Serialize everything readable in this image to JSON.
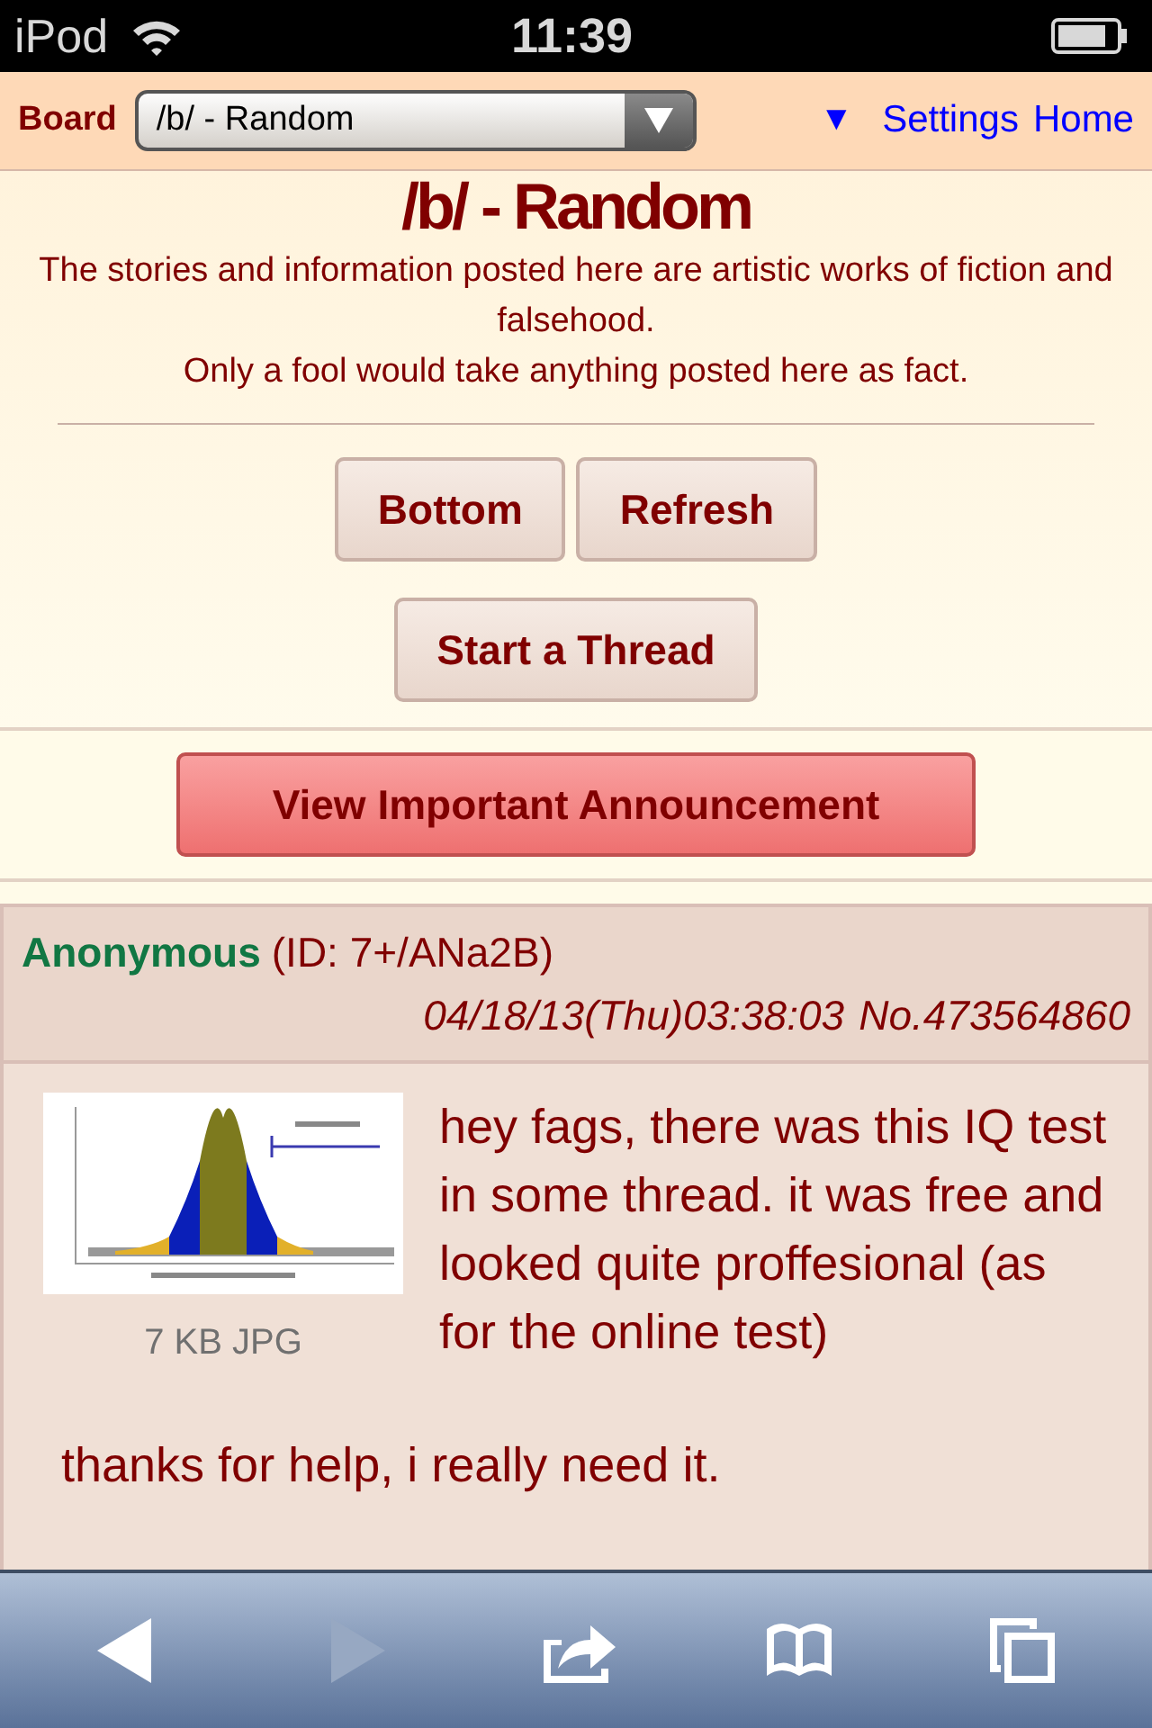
{
  "status_bar": {
    "carrier": "iPod",
    "time": "11:39"
  },
  "header": {
    "board_label": "Board",
    "board_select": "/b/ - Random",
    "links": [
      {
        "label": "▼"
      },
      {
        "label": "Settings"
      },
      {
        "label": "Home"
      }
    ]
  },
  "board_title": "/b/ - Random",
  "disclaimer": [
    "The stories and information posted here are artistic works of fiction and falsehood.",
    "Only a fool would take anything posted here as fact."
  ],
  "buttons": [
    [
      "Bottom",
      "Refresh"
    ],
    [
      "Start a Thread"
    ]
  ],
  "announcement_button": "View Important Announcement",
  "post": {
    "name": "Anonymous",
    "id": "(ID: 7+/ANa2B)",
    "datetime": "04/18/13(Thu)03:38:03",
    "number": "No.473564860",
    "thumbnail": {
      "kind": "picture",
      "info": "7 KB JPG"
    },
    "comment": [
      "hey fags, there was this IQ test in some thread. it was free and looked quite proffesional (as for the online test)",
      "thanks for help, i really need it."
    ]
  },
  "toolbar": [
    {
      "kind": "back",
      "disabled": false
    },
    {
      "kind": "forward",
      "disabled": true
    },
    {
      "kind": "share",
      "disabled": false
    },
    {
      "kind": "bookmarks",
      "disabled": false
    },
    {
      "kind": "tabs",
      "disabled": false
    }
  ]
}
